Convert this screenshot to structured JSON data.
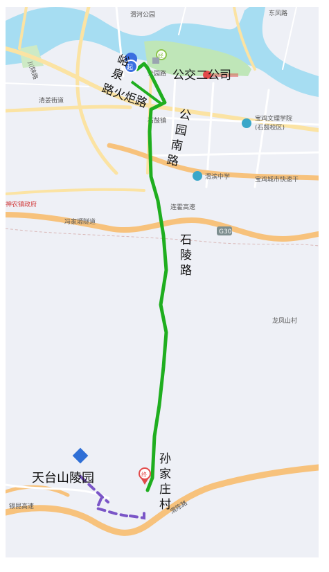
{
  "labels": {
    "weihe_park": "渭河公园",
    "dongfeng_road": "东风路",
    "chuanshan_road": "川陕路",
    "qingjiang_street": "清姜街道",
    "gongyuan_road": "公园路",
    "shigu_town": "石鼓镇",
    "school": "宝鸡文理学院",
    "school_campus": "(石鼓校区)",
    "weibin_school": "渭滨中学",
    "expressway": "宝鸡城市快速干",
    "gov": "神农镇政府",
    "lianhuo": "连霍高速",
    "fengjiashan": "冯家塬隧道",
    "g30": "G30",
    "longfeng": "龙凤山村",
    "yinkun": "银昆高速",
    "hushan": "渭陈路"
  },
  "annotations": {
    "gongjiao": "公交二公司",
    "yuquan_1": "峪",
    "yuquan_2": "泉",
    "huoju": "路火炬路",
    "gongyuannan_1": "公",
    "gongyuannan_2": "园",
    "gongyuannan_3": "南",
    "gongyuannan_4": "路",
    "shiling_1": "石",
    "shiling_2": "陵",
    "shiling_3": "路",
    "sunjia_1": "孙",
    "sunjia_2": "家",
    "sunjia_3": "庄",
    "sunjia_4": "村",
    "tiantai": "天台山陵园"
  },
  "markers": {
    "start": "起",
    "end": "终",
    "via": "经"
  },
  "colors": {
    "route": "#1fae1f",
    "walk": "#7a55c7",
    "water": "#a6ddf2",
    "park": "#bfe6b8",
    "highway": "#f7c27c",
    "start_marker": "#3b6fe0",
    "end_marker": "#e24a4a",
    "poi_diamond": "#2f6fd6"
  }
}
